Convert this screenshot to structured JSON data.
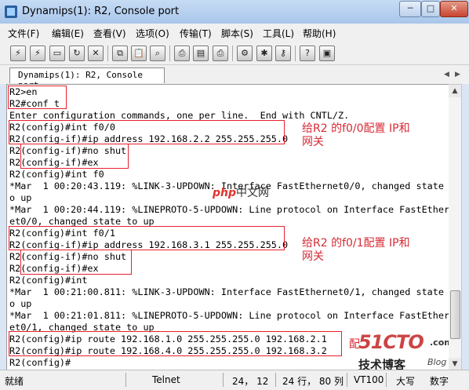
{
  "window": {
    "title": "Dynamips(1): R2, Console port"
  },
  "menu": [
    "文件(F)",
    "编辑(E)",
    "查看(V)",
    "选项(O)",
    "传输(T)",
    "脚本(S)",
    "工具(L)",
    "帮助(H)"
  ],
  "tab": {
    "label": "Dynamips(1): R2, Console port"
  },
  "terminal": {
    "lines": [
      "R2>en",
      "R2#conf t",
      "Enter configuration commands, one per line.  End with CNTL/Z.",
      "R2(config)#int f0/0",
      "R2(config-if)#ip address 192.168.2.2 255.255.255.0",
      "R2(config-if)#no shut",
      "R2(config-if)#ex",
      "R2(config)#int f0",
      "*Mar  1 00:20:43.119: %LINK-3-UPDOWN: Interface FastEthernet0/0, changed state t",
      "o up",
      "*Mar  1 00:20:44.119: %LINEPROTO-5-UPDOWN: Line protocol on Interface FastEthern",
      "et0/0, changed state to up",
      "R2(config)#int f0/1",
      "R2(config-if)#ip address 192.168.3.1 255.255.255.0",
      "R2(config-if)#no shut",
      "R2(config-if)#ex",
      "R2(config)#int",
      "*Mar  1 00:21:00.811: %LINK-3-UPDOWN: Interface FastEthernet0/1, changed state t",
      "o up",
      "*Mar  1 00:21:01.811: %LINEPROTO-5-UPDOWN: Line protocol on Interface FastEthern",
      "et0/1, changed state to up",
      "R2(config)#ip route 192.168.1.0 255.255.255.0 192.168.2.1",
      "R2(config)#ip route 192.168.4.0 255.255.255.0 192.168.3.2",
      "R2(config)#"
    ],
    "annotations": {
      "f0_0_line1": "给R2 的f0/0配置 IP和",
      "f0_0_line2": "网关",
      "f0_1_line1": "给R2 的f0/1配置 IP和",
      "f0_1_line2": "网关",
      "route_partial": "配"
    }
  },
  "watermarks": {
    "php_prefix": "php",
    "php_text": "中文网",
    "site_big": "51CTO",
    "site_com": ".com",
    "site_sub": "技术博客",
    "site_blog": "Blog"
  },
  "status": {
    "ready": "就绪",
    "protocol": "Telnet",
    "position": "24， 12",
    "size": "24 行， 80 列",
    "emulation": "VT100",
    "caps": "大写",
    "num": "数字"
  }
}
